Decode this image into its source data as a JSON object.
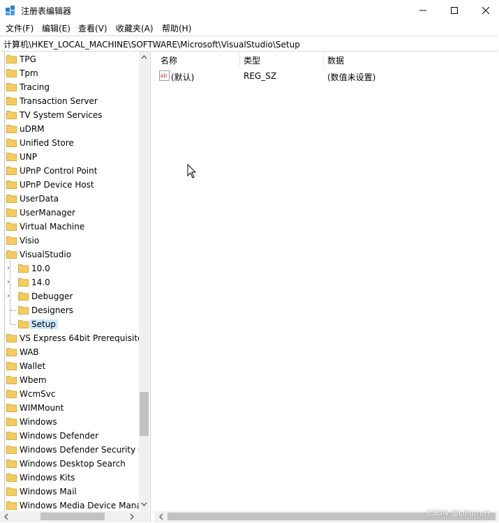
{
  "window": {
    "title": "注册表编辑器",
    "minimize_icon": "minimize-icon",
    "maximize_icon": "maximize-icon",
    "close_icon": "close-icon"
  },
  "menu": [
    {
      "label": "文件(F)"
    },
    {
      "label": "编辑(E)"
    },
    {
      "label": "查看(V)"
    },
    {
      "label": "收藏夹(A)"
    },
    {
      "label": "帮助(H)"
    }
  ],
  "address": "计算机\\HKEY_LOCAL_MACHINE\\SOFTWARE\\Microsoft\\VisualStudio\\Setup",
  "tree": {
    "items": [
      {
        "label": "TPG"
      },
      {
        "label": "Tpm"
      },
      {
        "label": "Tracing"
      },
      {
        "label": "Transaction Server"
      },
      {
        "label": "TV System Services"
      },
      {
        "label": "uDRM"
      },
      {
        "label": "Unified Store"
      },
      {
        "label": "UNP"
      },
      {
        "label": "UPnP Control Point"
      },
      {
        "label": "UPnP Device Host"
      },
      {
        "label": "UserData"
      },
      {
        "label": "UserManager"
      },
      {
        "label": "Virtual Machine"
      },
      {
        "label": "Visio"
      },
      {
        "label": "VisualStudio"
      },
      {
        "label": "10.0"
      },
      {
        "label": "14.0"
      },
      {
        "label": "Debugger"
      },
      {
        "label": "Designers"
      },
      {
        "label": "Setup"
      },
      {
        "label": "VS Express 64bit Prerequisite"
      },
      {
        "label": "WAB"
      },
      {
        "label": "Wallet"
      },
      {
        "label": "Wbem"
      },
      {
        "label": "WcmSvc"
      },
      {
        "label": "WIMMount"
      },
      {
        "label": "Windows"
      },
      {
        "label": "Windows Defender"
      },
      {
        "label": "Windows Defender Security C"
      },
      {
        "label": "Windows Desktop Search"
      },
      {
        "label": "Windows Kits"
      },
      {
        "label": "Windows Mail"
      },
      {
        "label": "Windows Media Device Mana"
      }
    ]
  },
  "values": {
    "columns": {
      "name": "名称",
      "type": "类型",
      "data": "数据"
    },
    "rows": [
      {
        "name": "(默认)",
        "type": "REG_SZ",
        "data": "(数值未设置)"
      }
    ]
  },
  "watermark": "CSDN @Lilium.H"
}
